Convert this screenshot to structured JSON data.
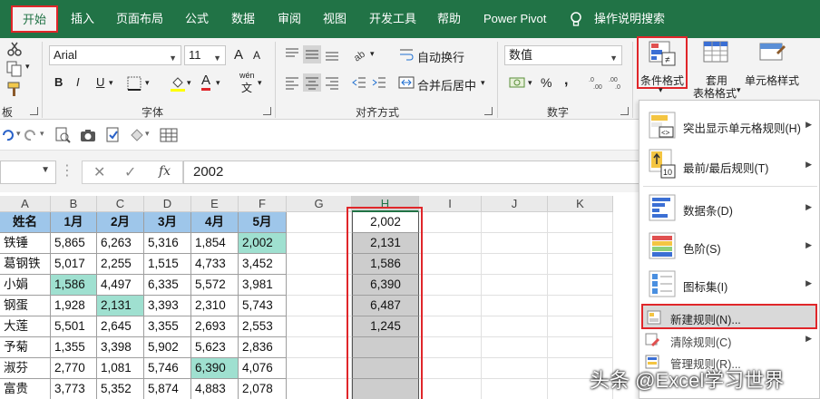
{
  "ribbon_tabs": [
    "开始",
    "插入",
    "页面布局",
    "公式",
    "数据",
    "审阅",
    "视图",
    "开发工具",
    "帮助",
    "Power Pivot",
    "操作说明搜索"
  ],
  "font": {
    "name": "Arial",
    "size": "11"
  },
  "font_buttons": {
    "bold": "B",
    "italic": "I",
    "underline": "U",
    "grow": "A",
    "shrink": "A",
    "fill_color": "A",
    "wen": "wén",
    "wen_char": "文"
  },
  "alignment": {
    "wrap": "自动换行",
    "merge": "合并后居中"
  },
  "number": {
    "format": "数值",
    "percent": "%",
    "comma": ","
  },
  "styles": {
    "conditional": "条件格式",
    "table_line1": "套用",
    "table_line2": "表格格式",
    "cell_styles": "单元格样式"
  },
  "group_labels": {
    "clipboard": "板",
    "font": "字体",
    "alignment": "对齐方式",
    "number": "数字"
  },
  "formula_bar": {
    "value": "2002",
    "fx": "fx"
  },
  "columns": [
    "A",
    "B",
    "C",
    "D",
    "E",
    "F",
    "G",
    "H",
    "I",
    "J",
    "K"
  ],
  "table": {
    "headers": [
      "姓名",
      "1月",
      "2月",
      "3月",
      "4月",
      "5月"
    ],
    "rows": [
      [
        "铁锤",
        "5,865",
        "6,263",
        "5,316",
        "1,854",
        "2,002"
      ],
      [
        "葛钢铁",
        "5,017",
        "2,255",
        "1,515",
        "4,733",
        "3,452"
      ],
      [
        "小娟",
        "1,586",
        "4,497",
        "6,335",
        "5,572",
        "3,981"
      ],
      [
        "钢蛋",
        "1,928",
        "2,131",
        "3,393",
        "2,310",
        "5,743"
      ],
      [
        "大莲",
        "5,501",
        "2,645",
        "3,355",
        "2,693",
        "2,553"
      ],
      [
        "予菊",
        "1,355",
        "3,398",
        "5,902",
        "5,623",
        "2,836"
      ],
      [
        "淑芬",
        "2,770",
        "1,081",
        "5,746",
        "6,390",
        "4,076"
      ],
      [
        "富贵",
        "3,773",
        "5,352",
        "5,874",
        "4,883",
        "2,078"
      ]
    ]
  },
  "h_column": [
    "2,002",
    "2,131",
    "1,586",
    "6,390",
    "6,487",
    "1,245",
    "",
    "",
    ""
  ],
  "menu": {
    "items": [
      "突出显示单元格规则(H)",
      "最前/最后规则(T)",
      "数据条(D)",
      "色阶(S)",
      "图标集(I)"
    ],
    "actions": [
      "新建规则(N)...",
      "清除规则(C)",
      "管理规则(R)..."
    ]
  },
  "watermark": "头条 @Excel学习世界",
  "colors": {
    "ribbon_green": "#217346",
    "header_blue": "#9ec6ea",
    "highlight_teal": "#9fe0d0",
    "annotation_red": "#e0262a"
  }
}
